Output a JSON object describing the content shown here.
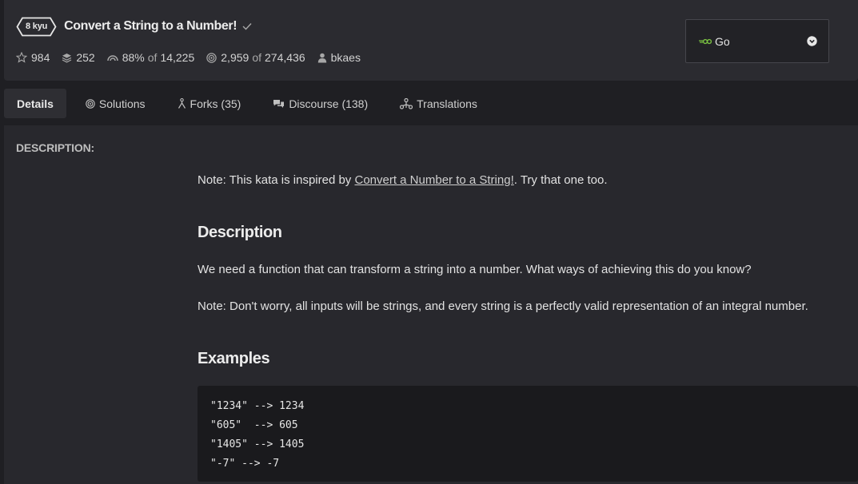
{
  "kata": {
    "rank": "8 kyu",
    "title": "Convert a String to a Number!"
  },
  "stats": {
    "stars": "984",
    "collections": "252",
    "satisfaction": "88%",
    "satisfaction_of": "of",
    "satisfaction_total": "14,225",
    "completed": "2,959",
    "completed_of": "of",
    "completed_total": "274,436",
    "author": "bkaes"
  },
  "language_select": {
    "label": "Go"
  },
  "tabs": [
    {
      "label": "Details"
    },
    {
      "label": "Solutions"
    },
    {
      "label": "Forks (35)"
    },
    {
      "label": "Discourse (138)"
    },
    {
      "label": "Translations"
    }
  ],
  "description": {
    "section_label": "DESCRIPTION:",
    "note_prefix": "Note: This kata is inspired by ",
    "note_link": "Convert a Number to a String!",
    "note_suffix": ". Try that one too.",
    "heading_description": "Description",
    "paragraph_1": "We need a function that can transform a string into a number. What ways of achieving this do you know?",
    "paragraph_2": "Note: Don't worry, all inputs will be strings, and every string is a perfectly valid representation of an integral number.",
    "heading_examples": "Examples",
    "code_lines": [
      "\"1234\" --> 1234",
      "\"605\"  --> 605",
      "\"1405\" --> 1405",
      "\"-7\" --> -7"
    ]
  },
  "colors": {
    "background": "#1f1f23",
    "header_bg": "#2b2b30",
    "panel_bg": "#28282d",
    "code_bg": "#1a1a1d",
    "go_accent": "#7ac142"
  },
  "icons": {
    "rank_badge": "hexagon-badge",
    "check": "check-icon",
    "stars": "star-icon",
    "collections": "layers-icon",
    "satisfaction": "rainbow-icon",
    "completed": "target-icon",
    "author": "user-icon",
    "language": "go-gopher-icon",
    "dropdown": "chevron-down-circle-icon"
  }
}
